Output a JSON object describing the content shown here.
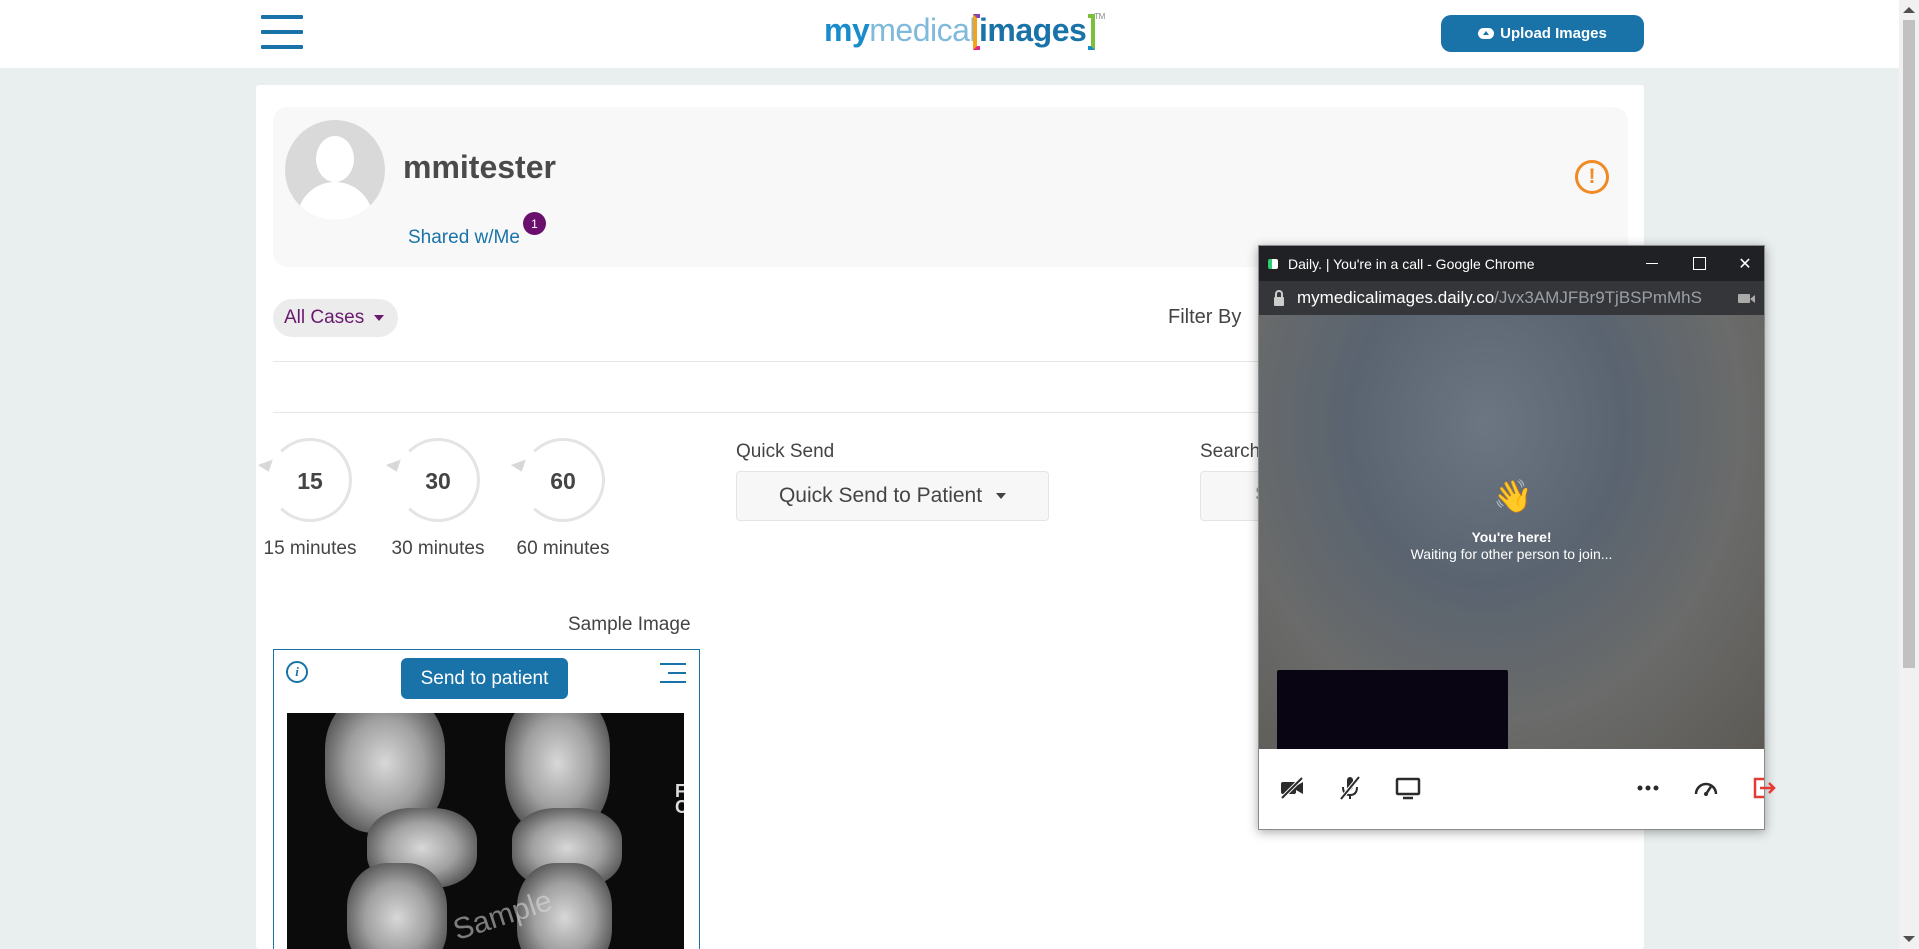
{
  "topbar": {
    "logo": {
      "my": "my",
      "medical": "medical",
      "images": "images",
      "tm": "TM"
    },
    "upload_button": "Upload Images"
  },
  "profile": {
    "username": "mmitester",
    "shared_link": "Shared w/Me",
    "shared_count": "1",
    "alert_symbol": "!"
  },
  "filters": {
    "all_cases": "All Cases",
    "filter_by": "Filter By"
  },
  "timers": [
    {
      "value": "15",
      "label": "15 minutes"
    },
    {
      "value": "30",
      "label": "30 minutes"
    },
    {
      "value": "60",
      "label": "60 minutes"
    }
  ],
  "quick_send": {
    "label": "Quick Send",
    "button": "Quick Send to Patient"
  },
  "search": {
    "label": "Search",
    "placeholder": "S"
  },
  "sample": {
    "title": "Sample Image",
    "send_button": "Send to patient",
    "watermark": "Sample",
    "edge_text": "F\nC"
  },
  "popup": {
    "title": "Daily. | You're in a call - Google Chrome",
    "url_host": "mymedicalimages.daily.co",
    "url_path": "/Jvx3AMJFBr9TjBSPmMhS",
    "emoji": "👋",
    "youre_here": "You're here!",
    "waiting": "Waiting for other person to join...",
    "toolbar_icons": [
      "camera-off-icon",
      "mic-off-icon",
      "screen-share-icon",
      "more-icon",
      "network-icon",
      "leave-icon"
    ]
  },
  "colors": {
    "brand_blue": "#1a73a8",
    "accent_purple": "#6a0f6e",
    "alert_orange": "#f08a24",
    "leave_red": "#e53935"
  }
}
